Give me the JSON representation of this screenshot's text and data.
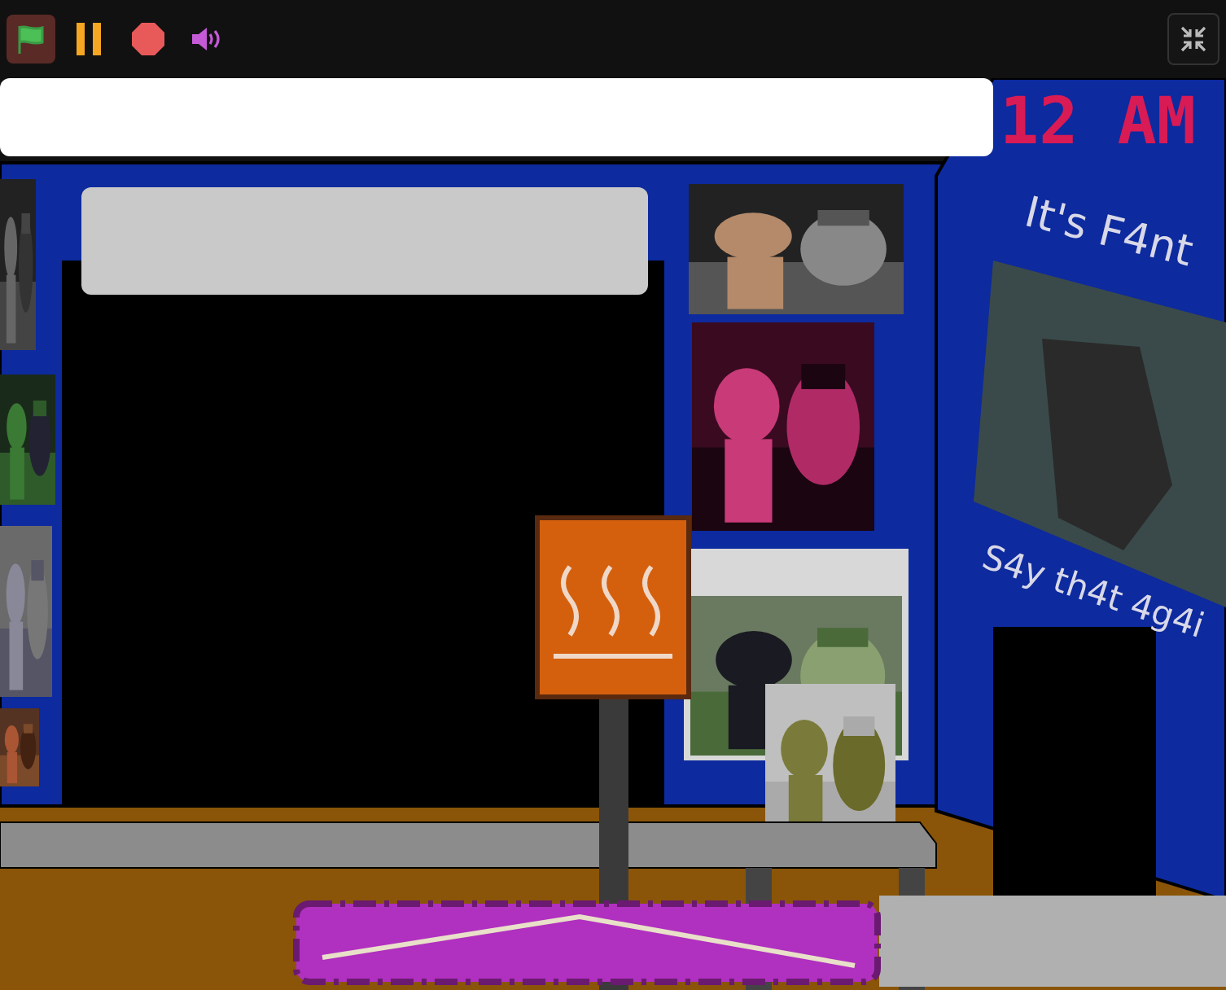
{
  "toolbar": {
    "flag_active": true
  },
  "clock": "12 AM",
  "wall_signs": [
    "It's F4nt",
    "S4y th4t 4g4i"
  ]
}
